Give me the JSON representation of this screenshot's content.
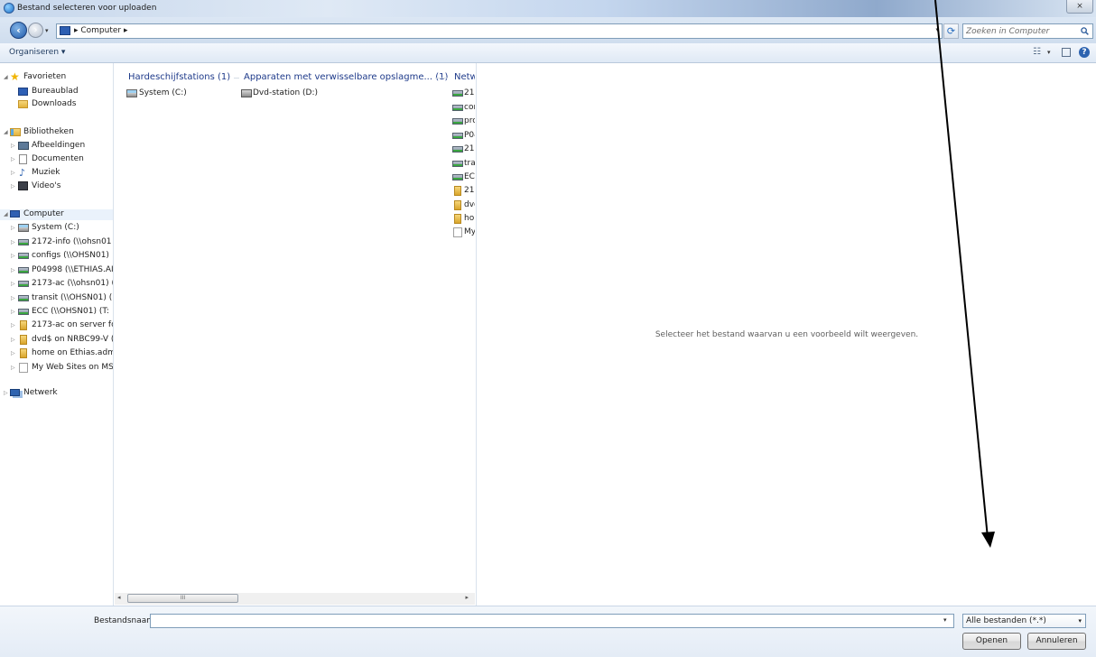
{
  "window": {
    "title": "Bestand selecteren voor uploaden",
    "close_symbol": "⨯"
  },
  "address_bar": {
    "path_text": "▸ Computer ▸",
    "search_placeholder": "Zoeken in Computer"
  },
  "toolbar": {
    "organize_label": "Organiseren ▾",
    "help_symbol": "?"
  },
  "nav": {
    "favorites": {
      "label": "Favorieten",
      "items": [
        "Bureaublad",
        "Downloads"
      ]
    },
    "libraries": {
      "label": "Bibliotheken",
      "items": [
        "Afbeeldingen",
        "Documenten",
        "Muziek",
        "Video's"
      ]
    },
    "computer": {
      "label": "Computer",
      "items": [
        "System (C:)",
        "2172-info (\\\\ohsn01",
        "configs (\\\\OHSN01)",
        "P04998 (\\\\ETHIAS.AI",
        "2173-ac (\\\\ohsn01) (",
        "transit (\\\\OHSN01) (",
        "ECC (\\\\OHSN01) (T:",
        "2173-ac on server fo",
        "dvd$ on NRBC99-V (",
        "home on Ethias.adm",
        "My Web Sites on MS"
      ]
    },
    "network": {
      "label": "Netwerk"
    }
  },
  "files": {
    "groups": [
      {
        "header": "Hardeschijfstations (1)",
        "items": [
          "System (C:)"
        ]
      },
      {
        "header": "Apparaten met verwisselbare opslagme... (1)",
        "items": [
          "Dvd-station (D:)"
        ]
      },
      {
        "header": "Netw",
        "items": [
          "217",
          "cor",
          "prc",
          "P04",
          "217",
          "trai",
          "ECC",
          "217",
          "dvc",
          "hor",
          "My"
        ]
      }
    ],
    "scroll_thumb_grip": "III"
  },
  "preview": {
    "message": "Selecteer het bestand waarvan u een voorbeeld wilt weergeven."
  },
  "bottom": {
    "filename_label": "Bestandsnaam:",
    "filename_value": "",
    "filetype_value": "Alle bestanden (*.*)",
    "open_label": "Openen",
    "cancel_label": "Annuleren"
  },
  "colors": {
    "accent_blue": "#1e3a8a",
    "annotation": "#000000"
  }
}
